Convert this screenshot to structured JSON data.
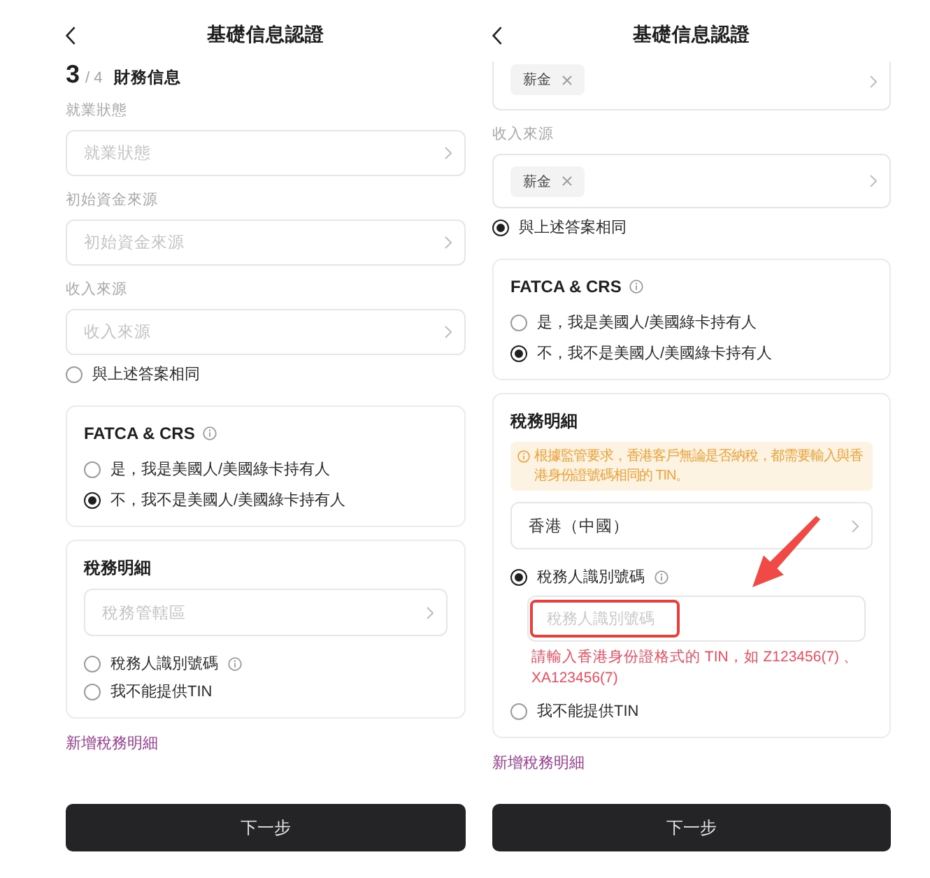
{
  "screens": [
    {
      "header": {
        "title": "基礎信息認證"
      },
      "step": {
        "current": "3",
        "total": "/ 4",
        "title": "財務信息"
      },
      "fields": [
        {
          "label": "就業狀態",
          "placeholder": "就業狀態"
        },
        {
          "label": "初始資金來源",
          "placeholder": "初始資金來源"
        },
        {
          "label": "收入來源",
          "placeholder": "收入來源"
        }
      ],
      "same_as_above": {
        "label": "與上述答案相同",
        "selected": false
      },
      "fatca": {
        "title": "FATCA & CRS",
        "info": true,
        "options": [
          {
            "label": "是，我是美國人/美國綠卡持有人",
            "selected": false
          },
          {
            "label": "不，我不是美國人/美國綠卡持有人",
            "selected": true
          }
        ]
      },
      "tax": {
        "title": "稅務明細",
        "jurisdiction": {
          "placeholder": "稅務管轄區"
        },
        "options": [
          {
            "label": "稅務人識別號碼",
            "info": true,
            "selected": false
          },
          {
            "label": "我不能提供TIN",
            "selected": false
          }
        ]
      },
      "add_link": "新增稅務明細",
      "next_button": "下一步"
    },
    {
      "header": {
        "title": "基礎信息認證"
      },
      "fields": [
        {
          "tags": [
            "薪金"
          ],
          "cut_off": true
        },
        {
          "label": "收入來源",
          "tags": [
            "薪金"
          ]
        }
      ],
      "same_as_above": {
        "label": "與上述答案相同",
        "selected": true
      },
      "fatca": {
        "title": "FATCA & CRS",
        "info": true,
        "options": [
          {
            "label": "是，我是美國人/美國綠卡持有人",
            "selected": false
          },
          {
            "label": "不，我不是美國人/美國綠卡持有人",
            "selected": true
          }
        ]
      },
      "tax": {
        "title": "稅務明細",
        "notice": "根據監管要求，香港客戶無論是否納稅，都需要輸入與香港身份證號碼相同的 TIN。",
        "jurisdiction": {
          "value": "香港（中國）"
        },
        "options": [
          {
            "label": "稅務人識別號碼",
            "info": true,
            "selected": true,
            "input": {
              "placeholder": "稅務人識別號碼",
              "highlighted": true
            },
            "error": "請輸入香港身份證格式的 TIN，如 Z123456(7) 、XA123456(7)"
          },
          {
            "label": "我不能提供TIN",
            "selected": false
          }
        ],
        "arrow": true
      },
      "add_link": "新增稅務明細",
      "next_button": "下一步"
    }
  ]
}
